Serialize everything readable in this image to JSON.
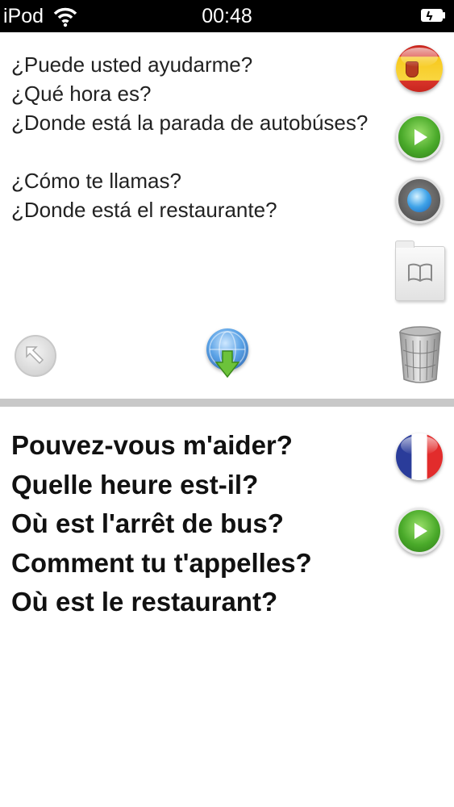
{
  "status_bar": {
    "carrier": "iPod",
    "time": "00:48"
  },
  "source": {
    "language_flag": "spain-flag-icon",
    "lines": [
      "¿Puede usted ayudarme?",
      "¿Qué hora es?",
      "¿Donde está la parada de autobúses?",
      "¿Cómo te llamas?",
      "¿Donde está el restaurante?"
    ]
  },
  "target": {
    "language_flag": "france-flag-icon",
    "lines": [
      "Pouvez-vous m'aider?",
      "Quelle heure est-il?",
      "Où est l'arrêt de bus?",
      "Comment tu t'appelles?",
      "Où est le restaurant?"
    ]
  },
  "icons": {
    "play": "play-icon",
    "record": "record-icon",
    "phrasebook": "book-icon",
    "back": "back-arrow-icon",
    "translate": "globe-download-icon",
    "trash": "trash-icon"
  },
  "colors": {
    "status_bar_bg": "#000000",
    "divider": "#c8c8c8",
    "play_green": "#4aaa2a"
  }
}
